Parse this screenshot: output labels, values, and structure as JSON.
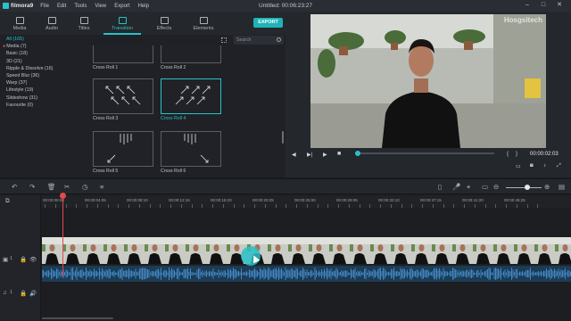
{
  "app": {
    "name": "filmora9",
    "title": "Untitled:",
    "timecode": "00:06:23:27"
  },
  "menu": [
    "File",
    "Edit",
    "Tools",
    "View",
    "Export",
    "Help"
  ],
  "library_tabs": [
    {
      "label": "Media",
      "icon": "folder-icon"
    },
    {
      "label": "Audio",
      "icon": "music-icon"
    },
    {
      "label": "Titles",
      "icon": "text-icon"
    },
    {
      "label": "Transition",
      "icon": "transition-icon",
      "active": true
    },
    {
      "label": "Effects",
      "icon": "effects-icon"
    },
    {
      "label": "Elements",
      "icon": "elements-icon"
    }
  ],
  "export_label": "EXPORT",
  "search_placeholder": "Search",
  "categories": [
    {
      "label": "All (165)",
      "active": true
    },
    {
      "label": "Media (7)",
      "dot": true
    },
    {
      "label": "Basic (18)"
    },
    {
      "label": "3D (21)"
    },
    {
      "label": "Ripple & Dissolve (16)"
    },
    {
      "label": "Speed Blur (36)"
    },
    {
      "label": "Warp (37)"
    },
    {
      "label": "Lifestyle (19)"
    },
    {
      "label": "Slideshow (31)"
    },
    {
      "label": "Favourite (0)"
    }
  ],
  "transitions": [
    {
      "name": "Cross Roll 1",
      "pattern": "roll1"
    },
    {
      "name": "Cross Roll 2",
      "pattern": "roll2"
    },
    {
      "name": "Cross Roll 3",
      "pattern": "roll3"
    },
    {
      "name": "Cross Roll 4",
      "pattern": "roll4",
      "selected": true
    },
    {
      "name": "Cross Roll 5",
      "pattern": "roll5"
    },
    {
      "name": "Cross Roll 6",
      "pattern": "roll6"
    }
  ],
  "preview": {
    "watermark": "Hosgsitech",
    "timecode": "00:00:02:03",
    "progress": 0.02
  },
  "ruler_labels": [
    "00:00:00:00",
    "00:00:04:05",
    "00:00:08:10",
    "00:00:12:15",
    "00:00:16:20",
    "00:00:20:25",
    "00:00:25:00",
    "00:00:29:05",
    "00:00:33:10",
    "00:00:37:15",
    "00:00:41:20",
    "00:00:45:25"
  ],
  "tracks": {
    "video": "1",
    "audio": "1"
  },
  "colors": {
    "accent": "#2ac1c7",
    "playhead": "#e5484d",
    "export": "#1fb3b8"
  }
}
